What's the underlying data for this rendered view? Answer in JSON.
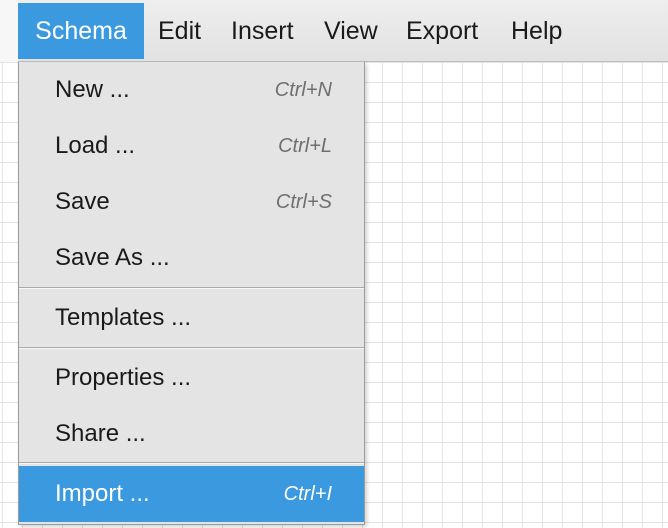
{
  "menubar": {
    "items": [
      {
        "label": "Schema"
      },
      {
        "label": "Edit"
      },
      {
        "label": "Insert"
      },
      {
        "label": "View"
      },
      {
        "label": "Export"
      },
      {
        "label": "Help"
      }
    ]
  },
  "dropdown": {
    "items": [
      {
        "label": "New ...",
        "shortcut": "Ctrl+N"
      },
      {
        "label": "Load ...",
        "shortcut": "Ctrl+L"
      },
      {
        "label": "Save",
        "shortcut": "Ctrl+S"
      },
      {
        "label": "Save As ...",
        "shortcut": ""
      },
      {
        "label": "Templates ...",
        "shortcut": ""
      },
      {
        "label": "Properties ...",
        "shortcut": ""
      },
      {
        "label": "Share ...",
        "shortcut": ""
      },
      {
        "label": "Import ...",
        "shortcut": "Ctrl+I"
      }
    ]
  },
  "colors": {
    "accent": "#3b99e0",
    "menubar_bg": "#e8e8e8",
    "dropdown_bg": "#e4e4e4"
  }
}
